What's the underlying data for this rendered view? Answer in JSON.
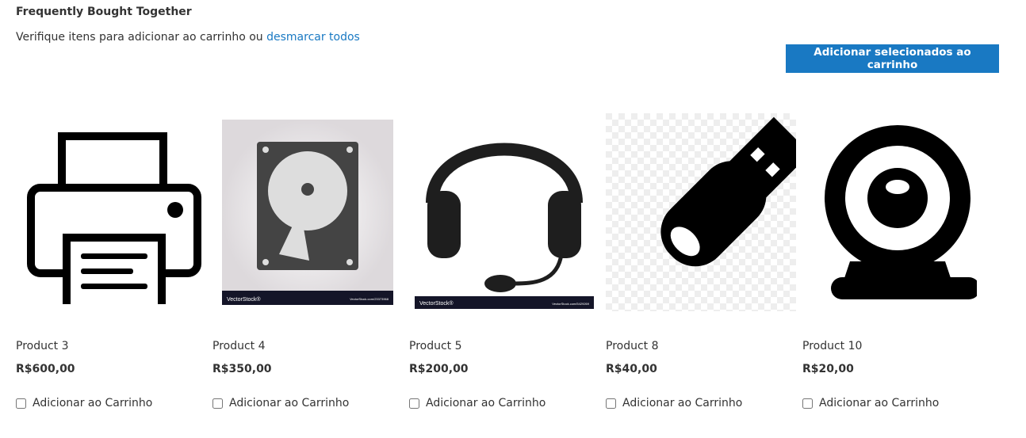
{
  "header": {
    "title": "Frequently Bought Together",
    "subtitle": "Verifique itens para adicionar ao carrinho ou",
    "unselect_link": "desmarcar todos",
    "add_selected_button": "Adicionar selecionados ao carrinho"
  },
  "colors": {
    "accent": "#1979c3"
  },
  "products": [
    {
      "name": "Product 3",
      "price": "R$600,00",
      "checkbox_label": "Adicionar ao Carrinho",
      "checked": false,
      "icon": "printer-icon"
    },
    {
      "name": "Product 4",
      "price": "R$350,00",
      "checkbox_label": "Adicionar ao Carrinho",
      "checked": false,
      "icon": "hard-drive-icon",
      "watermark": "VectorStock®",
      "watermark_url": "VectorStock.com/23373968"
    },
    {
      "name": "Product 5",
      "price": "R$200,00",
      "checkbox_label": "Adicionar ao Carrinho",
      "checked": false,
      "icon": "headset-icon",
      "watermark": "VectorStock®",
      "watermark_url": "VectorStock.com/5429269"
    },
    {
      "name": "Product 8",
      "price": "R$40,00",
      "checkbox_label": "Adicionar ao Carrinho",
      "checked": false,
      "icon": "usb-drive-icon"
    },
    {
      "name": "Product 10",
      "price": "R$20,00",
      "checkbox_label": "Adicionar ao Carrinho",
      "checked": false,
      "icon": "webcam-icon"
    }
  ]
}
